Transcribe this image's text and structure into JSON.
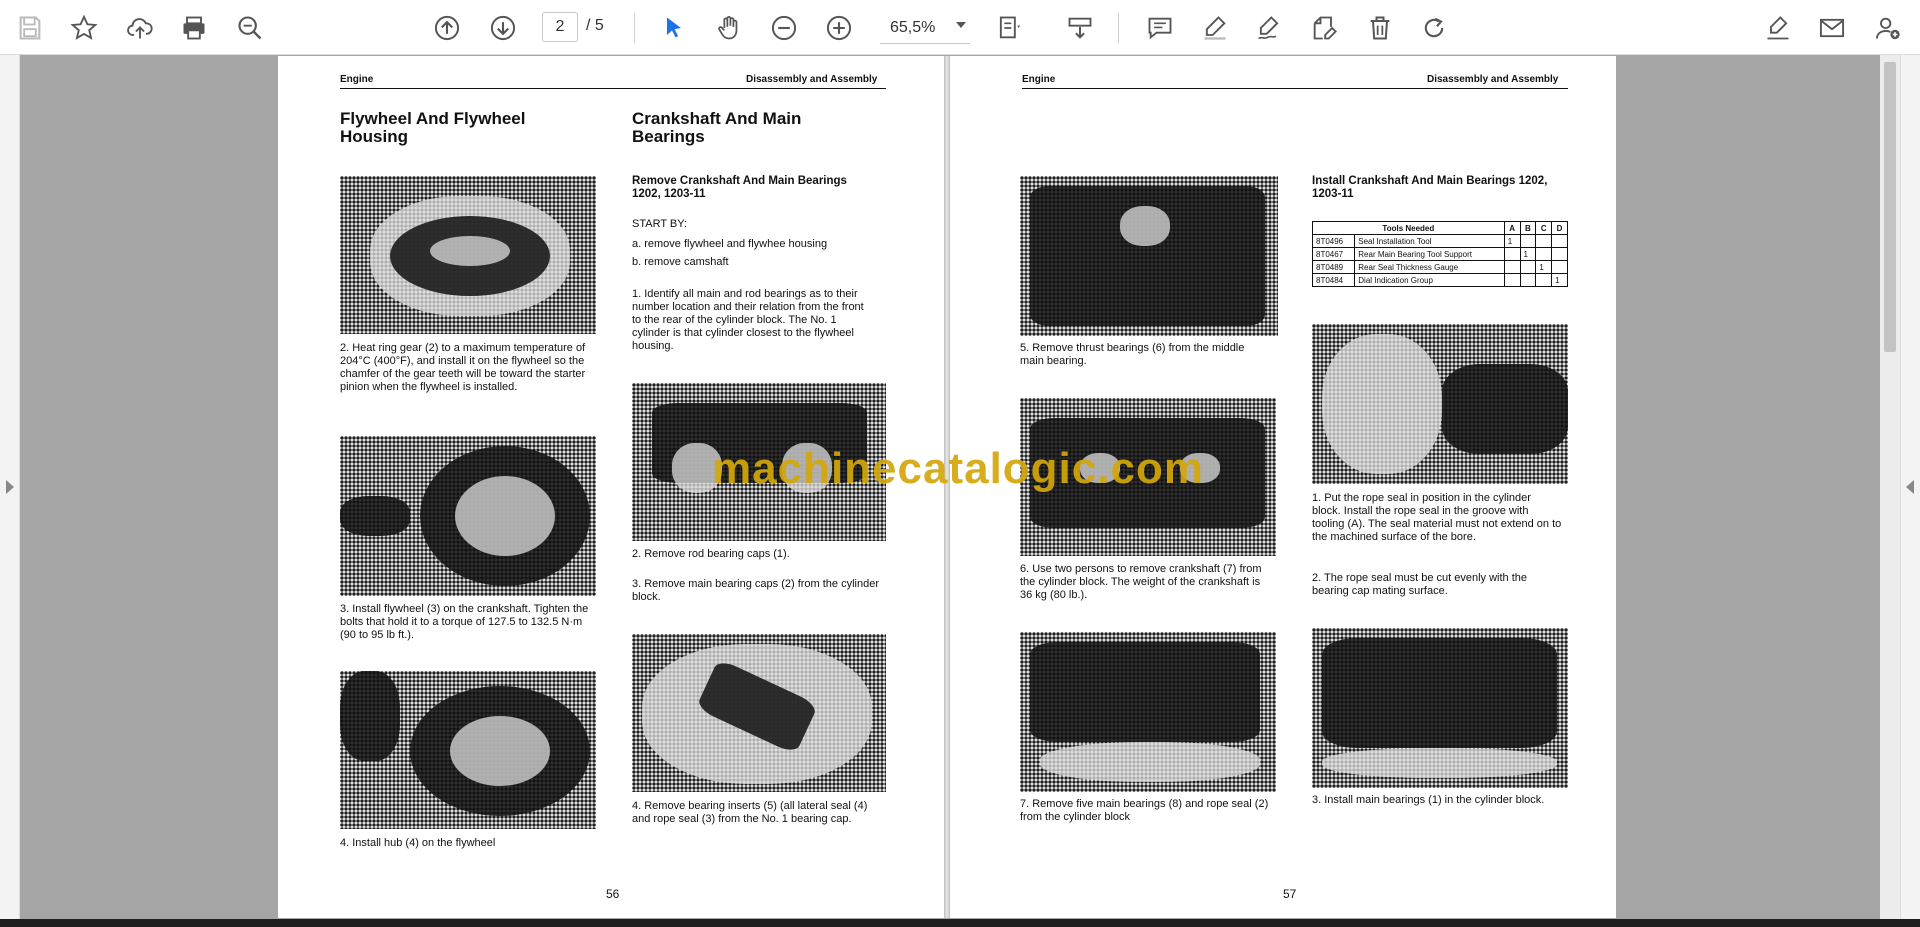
{
  "toolbar": {
    "page_current": "2",
    "page_total": "/ 5",
    "zoom": "65,5%",
    "icons": [
      "save-icon",
      "star-icon",
      "upload-cloud-icon",
      "print-icon",
      "zoom-search-icon",
      "arrow-up-circle-icon",
      "arrow-down-circle-icon",
      "cursor-icon",
      "hand-icon",
      "zoom-out-icon",
      "zoom-in-icon",
      "fit-page-icon",
      "scroll-mode-icon",
      "comment-icon",
      "highlight-icon",
      "draw-icon",
      "edit-icon",
      "delete-icon",
      "redo-icon",
      "sign-icon",
      "email-icon",
      "add-user-icon"
    ]
  },
  "left_page": {
    "header_left": "Engine",
    "header_right": "Disassembly and Assembly",
    "col1_title": "Flywheel And Flywheel Housing",
    "col2_title": "Crankshaft And Main Bearings",
    "col2_subtitle": "Remove Crankshaft And Main Bearings     1202, 1203-11",
    "start_by": "START BY:",
    "start_a": "a.  remove flywheel and flywhee  housing",
    "start_b": "b.  remove camshaft",
    "step1": "1. Identify all main and rod bearings as to their number location and their relation from the front to the rear of the cylinder block. The No. 1 cylinder is that cylinder closest to the flywheel housing.",
    "cap2_left": "2. Heat ring gear (2) to a maximum temperature of 204°C (400°F), and install it on the flywheel so the chamfer of the gear teeth will be toward the starter pinion when the flywheel is installed.",
    "cap3_left": "3. Install flywheel (3) on the crankshaft. Tighten the bolts that hold it to a torque of 127.5 to 132.5 N·m (90 to 95 lb ft.).",
    "cap4_left": "4. Install hub (4) on the flywheel",
    "cap2_right": "2. Remove rod bearing caps (1).",
    "cap3_right": "3. Remove main bearing caps (2) from the cylinder block.",
    "cap4_right": "4. Remove bearing inserts (5) (all lateral seal (4) and rope seal (3) from the No. 1 bearing cap.",
    "page_number": "56"
  },
  "right_page": {
    "header_left": "Engine",
    "header_right": "Disassembly and Assembly",
    "install_title": "Install Crankshaft And Main Bearings 1202, 1203-11",
    "table_header": [
      "Tools Needed",
      "A",
      "B",
      "C",
      "D"
    ],
    "table_rows": [
      [
        "8T0496",
        "Seal Installation Tool",
        "1",
        "",
        "",
        ""
      ],
      [
        "8T0467",
        "Rear Main Bearing Tool Support",
        "",
        "1",
        "",
        ""
      ],
      [
        "8T0489",
        "Rear Seal Thickness Gauge",
        "",
        "",
        "1",
        ""
      ],
      [
        "8T0484",
        "Dial Indication Group",
        "",
        "",
        "",
        "1"
      ]
    ],
    "cap5": "5. Remove thrust bearings (6) from the middle main bearing.",
    "cap6": "6. Use two persons to remove crankshaft (7) from the cylinder block. The weight of the crankshaft is 36 kg (80 lb.).",
    "cap7": "7. Remove five main bearings (8) and rope seal (2) from the cylinder block",
    "cap_i1": "1. Put the rope seal in position in the cylinder block. Install the rope seal in the groove with tooling (A). The seal material must not extend on to the machined surface of the bore.",
    "cap_i2": "2. The rope seal must be cut evenly with the bearing cap mating surface.",
    "cap_i3": "3. Install main bearings (1) in the cylinder block.",
    "page_number": "57"
  },
  "watermark": "machinecatalogic.com",
  "colors": {
    "accent": "#1a73e8",
    "watermark": "#d4a70a",
    "viewer_bg": "#a5a5a5"
  }
}
